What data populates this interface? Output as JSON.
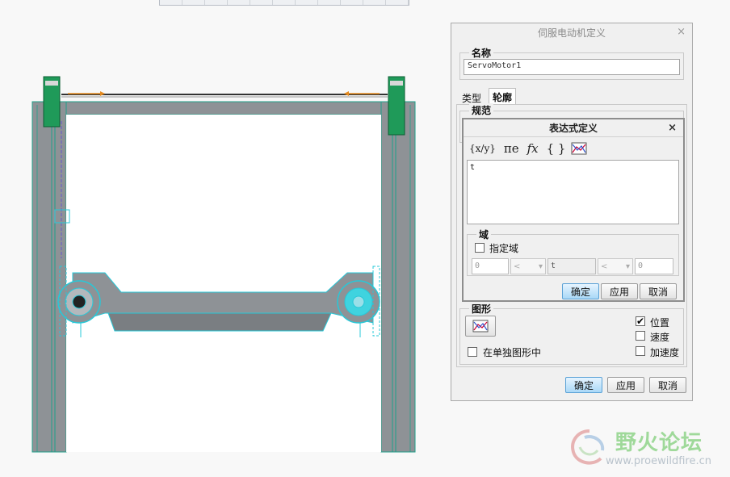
{
  "servo_dialog": {
    "title": "伺服电动机定义",
    "close": "×",
    "name_group": "名称",
    "name_value": "ServoMotor1",
    "tabs": [
      "类型",
      "轮廓"
    ],
    "spec_group": "规范",
    "graph_group": "图形",
    "separate_graph_label": "在单独图形中",
    "checks": [
      {
        "label": "位置",
        "checked": true
      },
      {
        "label": "速度",
        "checked": false
      },
      {
        "label": "加速度",
        "checked": false
      }
    ],
    "ok": "确定",
    "apply": "应用",
    "cancel": "取消"
  },
  "expr_dialog": {
    "title": "表达式定义",
    "close": "×",
    "tools": [
      "{x/y}",
      "πe",
      "fx",
      "{ }",
      "graph"
    ],
    "expression": "t",
    "domain_group": "域",
    "specify_domain_label": "指定域",
    "domain_min": "0",
    "domain_var": "t",
    "domain_max": "0",
    "op_left": "<",
    "op_right": "<",
    "ok": "确定",
    "apply": "应用",
    "cancel": "取消"
  },
  "watermark": {
    "text": "野火论坛",
    "url": "www.proewildfire.cn"
  },
  "colors": {
    "frame": "#8e9296",
    "frame_edge": "#1fa08a",
    "selection": "#27c8d8",
    "motor": "#1f9a59"
  }
}
